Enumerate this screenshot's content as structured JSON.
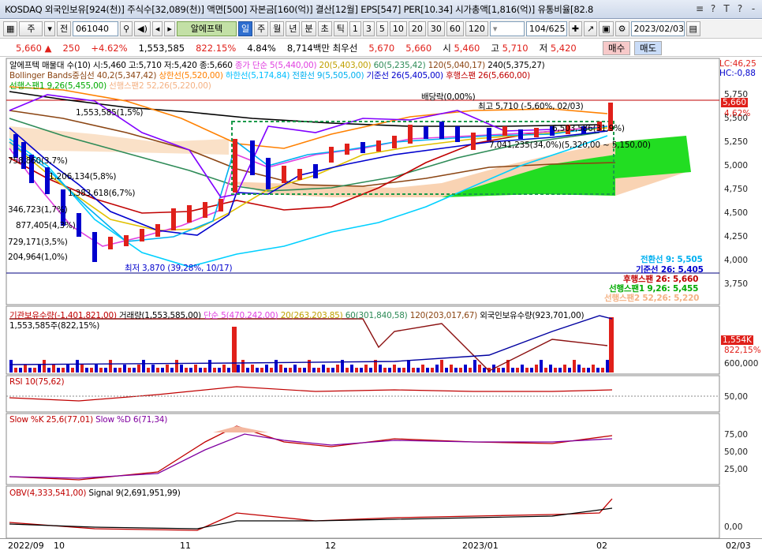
{
  "title": "KOSDAQ 외국인보유[924(천)] 주식수[32,089(천)] 액면[500] 자본금[160(억)] 결산[12월] EPS[547] PER[10.34] 시가총액[1,816(억)] 유통비율[82.8",
  "window_icons": [
    "≡",
    "?",
    "T",
    "?",
    "-"
  ],
  "toolbar": {
    "type": "주",
    "sub": "전",
    "code": "061040",
    "name": "알에프텍",
    "periods": [
      "일",
      "주",
      "월",
      "년",
      "분",
      "초",
      "틱"
    ],
    "intervals": [
      "1",
      "3",
      "5",
      "10",
      "20",
      "30",
      "60",
      "120"
    ],
    "page": "104/625",
    "date": "2023/02/03"
  },
  "quote": {
    "price": "5,660",
    "arrow": "▲",
    "change": "250",
    "pct": "+4.62%",
    "volume": "1,553,585",
    "vol_pct": "822.15%",
    "rate": "4.84%",
    "amount": "8,714백만",
    "pri_label": "최우선",
    "bid": "5,670",
    "ask": "5,660",
    "open_label": "시",
    "open": "5,460",
    "high_label": "고",
    "high": "5,710",
    "low_label": "저",
    "low": "5,420",
    "buy": "매수",
    "sell": "매도"
  },
  "price_panel": {
    "legend1": [
      {
        "text": "알에프텍 매물대 수(10)  시:5,460 고:5,710 저:5,420 종:5,660",
        "color": "#000000"
      },
      {
        "text": "종가 단순 5(5,440,00)",
        "color": "#e040e0"
      },
      {
        "text": "20(5,403,00)",
        "color": "#e0c000"
      },
      {
        "text": "60(5,235,42)",
        "color": "#2e8b57"
      },
      {
        "text": "120(5,040,17)",
        "color": "#8b4513"
      },
      {
        "text": "240(5,375,27)",
        "color": "#000000"
      }
    ],
    "legend2": [
      {
        "text": "Bollinger Bands중심선 40,2(5,347,42)",
        "color": "#8b4513"
      },
      {
        "text": "상한선(5,520,00)",
        "color": "#ff8000"
      },
      {
        "text": "하한선(5,174,84)",
        "color": "#00bfff"
      },
      {
        "text": "전환선 9(5,505,00)",
        "color": "#00b0f0"
      },
      {
        "text": "기준선 26(5,405,00)",
        "color": "#0000cd"
      },
      {
        "text": "후행스팬 26(5,660,00)",
        "color": "#c00000"
      }
    ],
    "legend3": [
      {
        "text": "선행스팬1 9,26(5,455,00)",
        "color": "#00aa00"
      },
      {
        "text": "선행스팬2 52,26(5,220,00)",
        "color": "#f4b183"
      }
    ],
    "lc": "LC:46,25",
    "hc": "HC:-0,88",
    "annotations": [
      {
        "text": "1,553,585(1,5%)",
        "color": "#000"
      },
      {
        "text": "758,860(3,7%)",
        "color": "#000"
      },
      {
        "text": "1,206,134(5,8%)",
        "color": "#000"
      },
      {
        "text": "1,383,618(6,7%)",
        "color": "#000"
      },
      {
        "text": "346,723(1,7%)",
        "color": "#000"
      },
      {
        "text": "877,405(4,3%)",
        "color": "#000"
      },
      {
        "text": "729,171(3,5%)",
        "color": "#000"
      },
      {
        "text": "204,964(1,0%)",
        "color": "#000"
      },
      {
        "text": "배당락(0,00%)",
        "color": "#000"
      },
      {
        "text": "최고 5,710 (-5,60%, 02/03)",
        "color": "#000"
      },
      {
        "text": "6,503,586(31,9%)",
        "color": "#000"
      },
      {
        "text": "7,041,235(34,0%)(5,320,00 ~ 5,150,00)",
        "color": "#000"
      },
      {
        "text": "최저 3,870 (39,28%, 10/17)",
        "color": "#0000cd"
      }
    ],
    "right_labels": [
      {
        "text": "전환선 9: 5,505",
        "color": "#00b0f0"
      },
      {
        "text": "기준선 26: 5,405",
        "color": "#0000cd"
      },
      {
        "text": "후행스팬 26: 5,660",
        "color": "#c00000"
      },
      {
        "text": "선행스팬1 9,26: 5,455",
        "color": "#00aa00"
      },
      {
        "text": "선행스팬2 52,26: 5,220",
        "color": "#f4b183"
      }
    ],
    "axis": [
      "5,750",
      "5,500",
      "5,250",
      "5,000",
      "4,750",
      "4,500",
      "4,250",
      "4,000",
      "3,750"
    ],
    "current": "5,660",
    "pct_label": "4,62%"
  },
  "volume_panel": {
    "legend": [
      {
        "text": "기관보유수량(-1,401,821,00)",
        "color": "#c00000"
      },
      {
        "text": "거래량(1,553,585,00)",
        "color": "#000000"
      },
      {
        "text": "단순 5(470,242,00)",
        "color": "#e040e0"
      },
      {
        "text": "20(263,203,85)",
        "color": "#e0c000"
      },
      {
        "text": "60(301,840,58)",
        "color": "#2e8b57"
      },
      {
        "text": "120(203,017,67)",
        "color": "#8b4513"
      },
      {
        "text": "외국인보유수량(923,701,00)",
        "color": "#000000"
      }
    ],
    "note": "1,553,585주(822,15%)",
    "axis": [
      "600,000"
    ],
    "box": "1,554K",
    "pct": "822,15%"
  },
  "rsi_panel": {
    "legend": "RSI 10(75,62)",
    "axis": [
      "50,00"
    ]
  },
  "slow_panel": {
    "legend_k": "Slow %K 25,6(77,01)",
    "legend_d": "Slow %D 6(71,34)",
    "axis": [
      "75,00",
      "50,00",
      "25,00"
    ]
  },
  "obv_panel": {
    "legend_obv": "OBV(4,333,541,00)",
    "legend_sig": "Signal 9(2,691,951,99)",
    "axis": [
      "0,00"
    ]
  },
  "x_axis": [
    "2022/09",
    "10",
    "11",
    "12",
    "2023/01",
    "02",
    "02/03"
  ]
}
